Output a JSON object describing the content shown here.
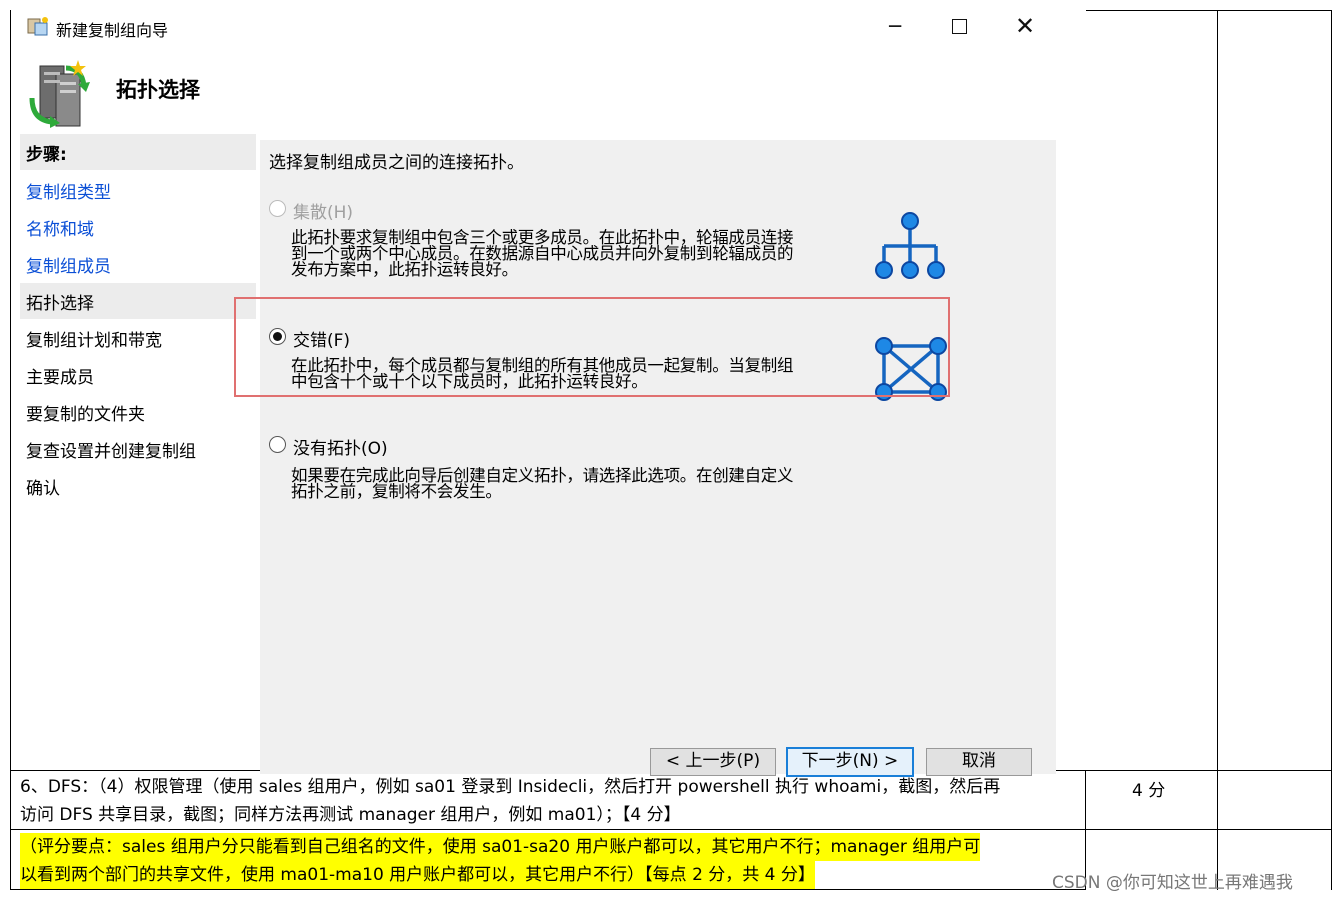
{
  "dialog": {
    "title": "新建复制组向导",
    "header_title": "拓扑选择",
    "steps_heading": "步骤:",
    "steps": [
      {
        "label": "复制组类型",
        "state": "link"
      },
      {
        "label": "名称和域",
        "state": "link"
      },
      {
        "label": "复制组成员",
        "state": "link"
      },
      {
        "label": "拓扑选择",
        "state": "current"
      },
      {
        "label": "复制组计划和带宽",
        "state": "normal"
      },
      {
        "label": "主要成员",
        "state": "normal"
      },
      {
        "label": "要复制的文件夹",
        "state": "normal"
      },
      {
        "label": "复查设置并创建复制组",
        "state": "normal"
      },
      {
        "label": "确认",
        "state": "normal"
      }
    ],
    "instruction": "选择复制组成员之间的连接拓扑。",
    "options": [
      {
        "label": "集散(H)",
        "desc_line1": "此拓扑要求复制组中包含三个或更多成员。在此拓扑中，轮辐成员连接",
        "desc_line2": "到一个或两个中心成员。在数据源自中心成员并向外复制到轮辐成员的",
        "desc_line3": "发布方案中，此拓扑运转良好。",
        "checked": false,
        "enabled": false,
        "icon": "hub-spoke-icon"
      },
      {
        "label": "交错(F)",
        "desc_line1": "在此拓扑中，每个成员都与复制组的所有其他成员一起复制。当复制组",
        "desc_line2": "中包含十个或十个以下成员时，此拓扑运转良好。",
        "checked": true,
        "enabled": true,
        "icon": "full-mesh-icon"
      },
      {
        "label": "没有拓扑(O)",
        "desc_line1": "如果要在完成此向导后创建自定义拓扑，请选择此选项。在创建自定义",
        "desc_line2": "拓扑之前，复制将不会发生。",
        "checked": false,
        "enabled": true
      }
    ],
    "buttons": {
      "prev": "< 上一步(P)",
      "next": "下一步(N) >",
      "cancel": "取消"
    },
    "colors": {
      "link": "#0b4fd6",
      "accent": "#1a7fd8",
      "highlight_border": "#e07070",
      "topology_blue": "#1565c0"
    }
  },
  "document": {
    "task_line1": "6、DFS：（4）权限管理（使用 sales 组用户，例如 sa01 登录到 Insidecli，然后打开 powershell 执行 whoami，截图，然后再",
    "task_line2": "访问 DFS 共享目录，截图；同样方法再测试 manager 组用户，例如 ma01）；【4 分】",
    "score": "4 分",
    "criteria_line1": "（评分要点：sales 组用户分只能看到自己组名的文件，使用 sa01-sa20 用户账户都可以，其它用户不行；manager 组用户可",
    "criteria_line2": "以看到两个部门的共享文件，使用 ma01-ma10 用户账户都可以，其它用户不行）【每点 2 分，共 4 分】",
    "watermark": "CSDN @你可知这世上再难遇我"
  }
}
